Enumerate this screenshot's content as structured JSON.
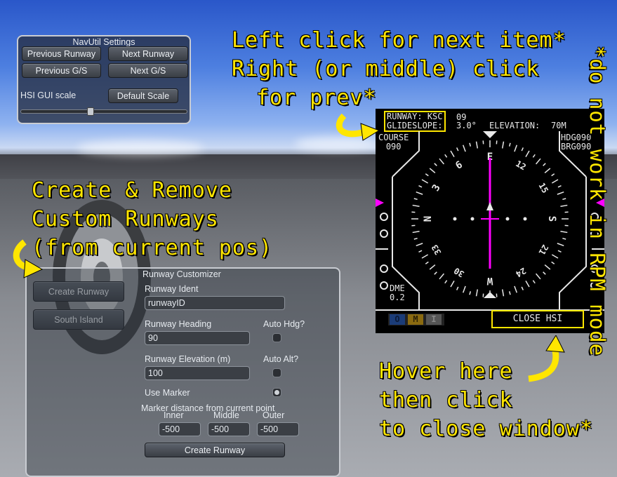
{
  "settings": {
    "title": "NavUtil Settings",
    "prev_runway": "Previous Runway",
    "next_runway": "Next Runway",
    "prev_gs": "Previous G/S",
    "next_gs": "Next G/S",
    "scale_label": "HSI GUI scale",
    "default_scale": "Default Scale",
    "scale_value": 0.42
  },
  "hints": {
    "left_click_line1": "Left click for next item*",
    "left_click_line2": "Right (or middle) click",
    "left_click_line3": "for prev*",
    "create_line1": "Create & Remove",
    "create_line2": "Custom Runways",
    "create_line3": "(from current pos)",
    "hover_line1": "Hover here",
    "hover_line2": "then click",
    "hover_line3": "to close window*",
    "rpm_note": "*do not work in RPM mode"
  },
  "runway_list": {
    "create_button": "Create Runway",
    "south_island": "South Island"
  },
  "customizer": {
    "title": "Runway Customizer",
    "ident_label": "Runway Ident",
    "ident_value": "runwayID",
    "heading_label": "Runway Heading",
    "heading_value": "90",
    "auto_hdg": "Auto Hdg?",
    "elevation_label": "Runway Elevation (m)",
    "elevation_value": "100",
    "auto_alt": "Auto Alt?",
    "use_marker": "Use Marker",
    "use_marker_on": true,
    "marker_dist_label": "Marker distance from current point",
    "inner_label": "Inner",
    "middle_label": "Middle",
    "outer_label": "Outer",
    "inner_value": "-500",
    "middle_value": "-500",
    "outer_value": "-500",
    "create_button": "Create Runway"
  },
  "hsi": {
    "runway_label": "RUNWAY:",
    "runway_name": "KSC",
    "runway_num": "09",
    "glideslope_label": "GLIDESLOPE:",
    "glideslope_value": "3.0°",
    "elevation_label": "ELEVATION:",
    "elevation_value": "70M",
    "course_label": "COURSE",
    "course_value": "090",
    "hdg": "HDG090",
    "brg": "BRG090",
    "dme_label": "DME",
    "dme_value": "0.2",
    "marker_o": "O",
    "marker_m": "M",
    "marker_i": "I",
    "close_button": "CLOSE HSI",
    "compass_labels": [
      "E",
      "12",
      "15",
      "S",
      "21",
      "24",
      "W",
      "30",
      "33",
      "N",
      "3",
      "6"
    ],
    "accent_magenta": "#ff00ff",
    "highlight_yellow": "#ffe600"
  }
}
